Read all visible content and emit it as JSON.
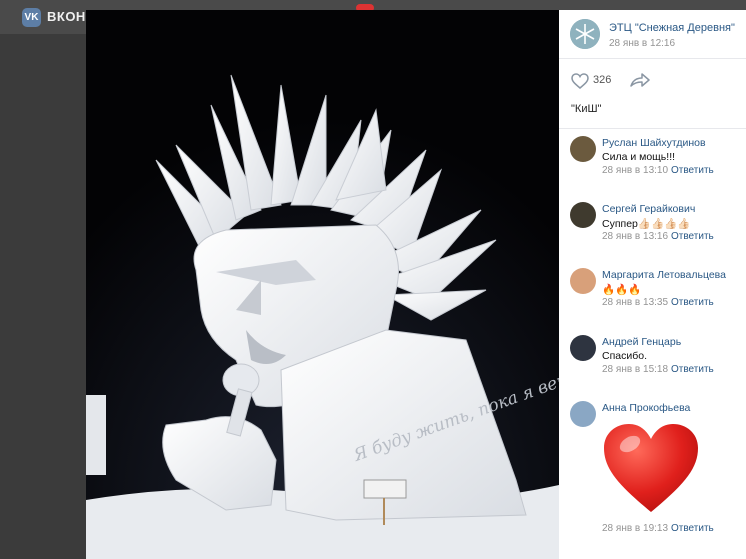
{
  "header": {
    "brand": "ВКОНТ",
    "logo_text": "VK"
  },
  "post": {
    "group_name": "ЭТЦ \"Снежная Деревня\"",
    "date": "28 янв в 12:16",
    "likes": "326",
    "caption": "\"КиШ\""
  },
  "comments": [
    {
      "name": "Руслан Шайхутдинов",
      "text": "Сила и мощь!!!",
      "date": "28 янв в 13:10",
      "reply": "Ответить"
    },
    {
      "name": "Сергей Герайкович",
      "text": "Суппер👍🏻👍🏻👍🏻👍🏻",
      "date": "28 янв в 13:16",
      "reply": "Ответить"
    },
    {
      "name": "Маргарита Летовальцева",
      "text": "🔥🔥🔥",
      "date": "28 янв в 13:35",
      "reply": "Ответить"
    },
    {
      "name": "Андрей Генцарь",
      "text": "Спасибо.",
      "date": "28 янв в 15:18",
      "reply": "Ответить"
    },
    {
      "name": "Анна Прокофьева",
      "text": "",
      "date": "28 янв в 19:13",
      "reply": "Ответить"
    }
  ],
  "photo": {
    "sculpture_text": "Я буду жить, пока я вечно"
  },
  "colors": {
    "link": "#2a5885",
    "muted": "#939393",
    "heart": "#e0201c"
  }
}
